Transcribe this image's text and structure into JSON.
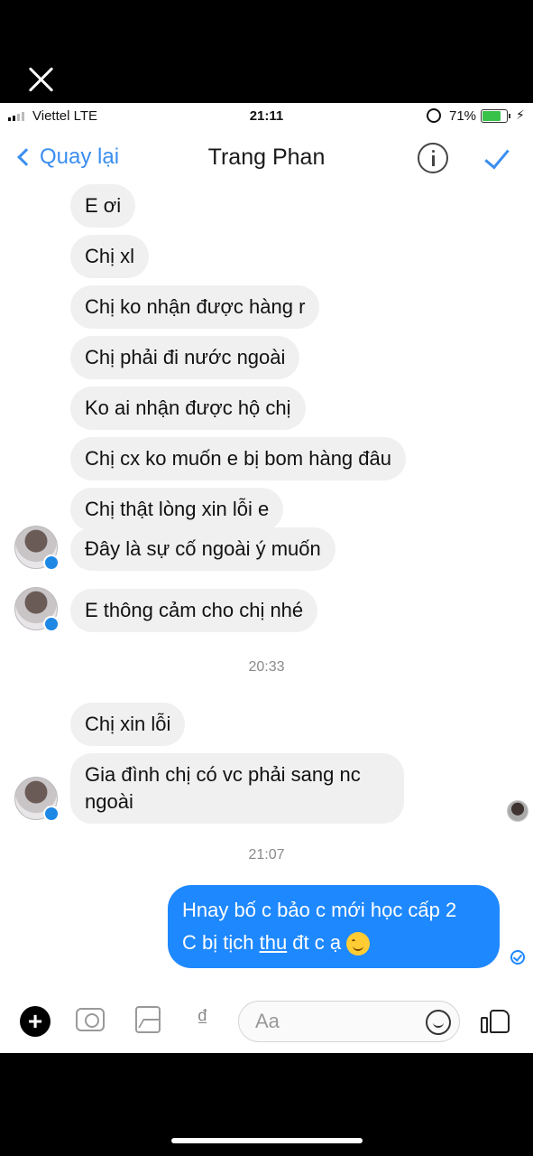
{
  "status_bar": {
    "carrier": "Viettel  LTE",
    "time": "21:11",
    "battery": "71%",
    "battery_level": 0.71
  },
  "nav": {
    "back_label": "Quay lại",
    "title": "Trang Phan"
  },
  "messages": {
    "m1": "E ơi",
    "m2": "Chị xl",
    "m3": "Chị ko nhận được hàng r",
    "m4": "Chị phải đi nước ngoài",
    "m5": "Ko ai nhận được hộ chị",
    "m6": "Chị cx ko muốn e bị bom hàng đâu",
    "m7": "Chị thật lòng xin lỗi e",
    "m8": "Đây là sự cố ngoài ý muốn",
    "m9": "E thông cảm cho chị nhé",
    "ts1": "20:33",
    "m10": "Chị xin lỗi",
    "m11": "Gia đình chị có vc phải sang nc ngoài",
    "ts2": "21:07",
    "sent_line1": "Hnay bố c bảo c mới học cấp 2",
    "sent_line2_pre": "C bị tịch ",
    "sent_line2_link": "thu",
    "sent_line2_post": " đt c ạ"
  },
  "composer": {
    "placeholder": "Aa",
    "currency_symbol": "₫"
  },
  "colors": {
    "accent": "#3b8ef0",
    "sent_bubble": "#1e88ff",
    "received_bubble": "#f0f0f0"
  },
  "icons": [
    "close-icon",
    "info-icon",
    "checkmark-icon",
    "plus-icon",
    "camera-icon",
    "image-icon",
    "emoji-icon",
    "like-icon",
    "seen-icon",
    "smiling-face-emoji"
  ]
}
